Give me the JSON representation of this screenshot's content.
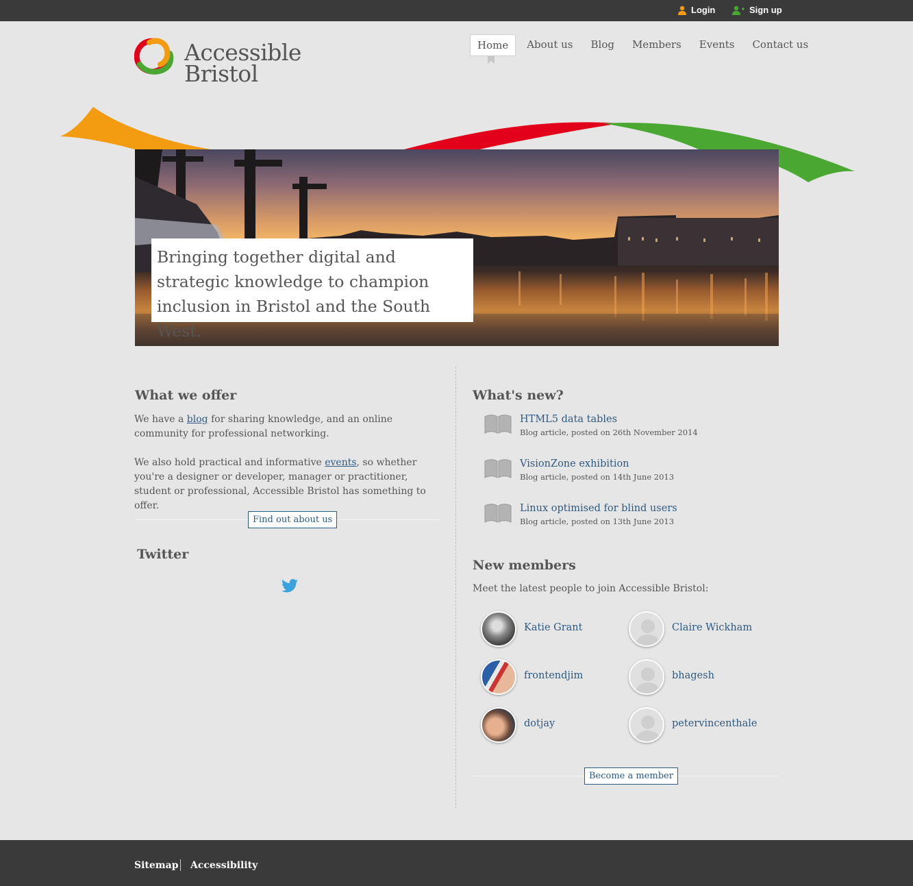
{
  "account": {
    "login_label": "Login",
    "signup_label": "Sign up"
  },
  "logo": {
    "line1": "Accessible",
    "line2": "Bristol"
  },
  "nav": {
    "items": [
      {
        "label": "Home",
        "active": true
      },
      {
        "label": "About us"
      },
      {
        "label": "Blog"
      },
      {
        "label": "Members"
      },
      {
        "label": "Events"
      },
      {
        "label": "Contact us"
      }
    ]
  },
  "hero": {
    "caption": "Bringing together digital and strategic knowledge to champion inclusion in Bristol and the South West."
  },
  "offer": {
    "heading": "What we offer",
    "p1_pre": "We have a ",
    "p1_link": "blog",
    "p1_post": " for sharing knowledge, and an online community for professional networking.",
    "p2_pre": "We also hold practical and informative ",
    "p2_link": "events",
    "p2_post": ", so whether you're a designer or developer, manager or practitioner, student or professional, Accessible Bristol has something to offer.",
    "button": "Find out about us"
  },
  "twitter": {
    "heading": "Twitter"
  },
  "whats_new": {
    "heading": "What's new?",
    "items": [
      {
        "title": "HTML5 data tables",
        "meta": "Blog article, posted on 26th November 2014"
      },
      {
        "title": "VisionZone exhibition",
        "meta": "Blog article, posted on 14th June 2013"
      },
      {
        "title": "Linux optimised for blind users",
        "meta": "Blog article, posted on 13th June 2013"
      }
    ]
  },
  "members": {
    "heading": "New members",
    "intro": "Meet the latest people to join Accessible Bristol:",
    "list": [
      {
        "name": "Katie Grant"
      },
      {
        "name": "Claire Wickham"
      },
      {
        "name": "frontendjim"
      },
      {
        "name": "bhagesh"
      },
      {
        "name": "dotjay"
      },
      {
        "name": "petervincenthale"
      }
    ],
    "button": "Become a member"
  },
  "footer": {
    "sitemap": "Sitemap",
    "accessibility": "Accessibility"
  },
  "colors": {
    "topbar": "#3a3a3a",
    "background": "#e6e6e6",
    "link": "#2d5a80",
    "orange": "#f39c12",
    "red": "#e3001b",
    "green": "#4aa832",
    "twitter": "#3aa3dd"
  }
}
